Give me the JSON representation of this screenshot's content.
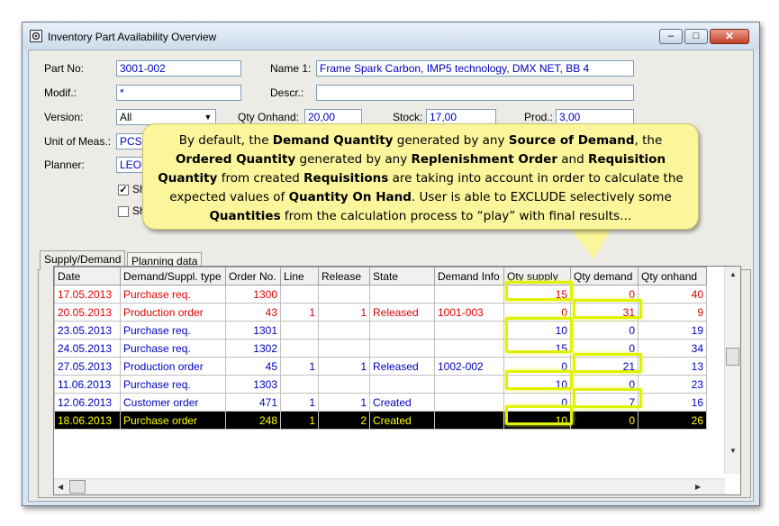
{
  "window": {
    "title": "Inventory Part Availability Overview",
    "buttons": {
      "minimize": "–",
      "maximize": "□",
      "close": "✕"
    }
  },
  "form": {
    "part_no_label": "Part No:",
    "part_no": "3001-002",
    "name1_label": "Name 1:",
    "name1": "Frame Spark Carbon, IMP5 technology, DMX NET, BB 4",
    "modif_label": "Modif.:",
    "modif": "*",
    "descr_label": "Descr.:",
    "descr": "",
    "version_label": "Version:",
    "version": "All",
    "qty_onhand_label": "Qty Onhand:",
    "qty_onhand": "20,00",
    "stock_label": "Stock:",
    "stock": "17,00",
    "prod_label": "Prod.:",
    "prod": "3,00",
    "uom_label": "Unit of Meas.:",
    "uom": "PCS",
    "planner_label": "Planner:",
    "planner": "LEON",
    "check1_label": "Sh",
    "check1": true,
    "check2_label": "Sh",
    "check2": false
  },
  "tabs": [
    "Supply/Demand",
    "Planning data"
  ],
  "table": {
    "columns": [
      "Date",
      "Demand/Suppl. type",
      "Order No.",
      "Line",
      "Release",
      "State",
      "Demand Info",
      "Qty supply",
      "Qty demand",
      "Qty onhand"
    ],
    "rows": [
      {
        "style": "red",
        "cells": [
          "17.05.2013",
          "Purchase req.",
          "1300",
          "",
          "",
          "",
          "",
          "15",
          "0",
          "40"
        ]
      },
      {
        "style": "red",
        "cells": [
          "20.05.2013",
          "Production order",
          "43",
          "1",
          "1",
          "Released",
          "1001-003",
          "0",
          "31",
          "9"
        ]
      },
      {
        "style": "blue",
        "cells": [
          "23.05.2013",
          "Purchase req.",
          "1301",
          "",
          "",
          "",
          "",
          "10",
          "0",
          "19"
        ]
      },
      {
        "style": "blue",
        "cells": [
          "24.05.2013",
          "Purchase req.",
          "1302",
          "",
          "",
          "",
          "",
          "15",
          "0",
          "34"
        ]
      },
      {
        "style": "blue",
        "cells": [
          "27.05.2013",
          "Production order",
          "45",
          "1",
          "1",
          "Released",
          "1002-002",
          "0",
          "21",
          "13"
        ]
      },
      {
        "style": "blue",
        "cells": [
          "11.06.2013",
          "Purchase req.",
          "1303",
          "",
          "",
          "",
          "",
          "10",
          "0",
          "23"
        ]
      },
      {
        "style": "blue",
        "cells": [
          "12.06.2013",
          "Customer order",
          "471",
          "1",
          "1",
          "Created",
          "",
          "0",
          "7",
          "16"
        ]
      },
      {
        "style": "sel",
        "cells": [
          "18.06.2013",
          "Purchase order",
          "248",
          "1",
          "2",
          "Created",
          "",
          "10",
          "0",
          "26"
        ]
      }
    ]
  },
  "callout": {
    "segments": [
      {
        "t": "By default, the ",
        "b": false
      },
      {
        "t": "Demand Quantity",
        "b": true
      },
      {
        "t": " generated by any ",
        "b": false
      },
      {
        "t": "Source of Demand",
        "b": true
      },
      {
        "t": ", the ",
        "b": false
      },
      {
        "t": "Ordered Quantity",
        "b": true
      },
      {
        "t": " generated by any ",
        "b": false
      },
      {
        "t": "Replenishment Order",
        "b": true
      },
      {
        "t": " and ",
        "b": false
      },
      {
        "t": "Requisition Quantity",
        "b": true
      },
      {
        "t": " from created ",
        "b": false
      },
      {
        "t": "Requisitions",
        "b": true
      },
      {
        "t": " are taking into account in order to calculate the expected values of ",
        "b": false
      },
      {
        "t": "Quantity On Hand",
        "b": true
      },
      {
        "t": ".  User is able to EXCLUDE selectively some ",
        "b": false
      },
      {
        "t": "Quantities",
        "b": true
      },
      {
        "t": " from the calculation process to “play” with final results…",
        "b": false
      }
    ]
  },
  "colors": {
    "highlight": "#dff200",
    "callout": "#fbf59b",
    "red_text": "#e00000",
    "blue_text": "#0000c0"
  }
}
